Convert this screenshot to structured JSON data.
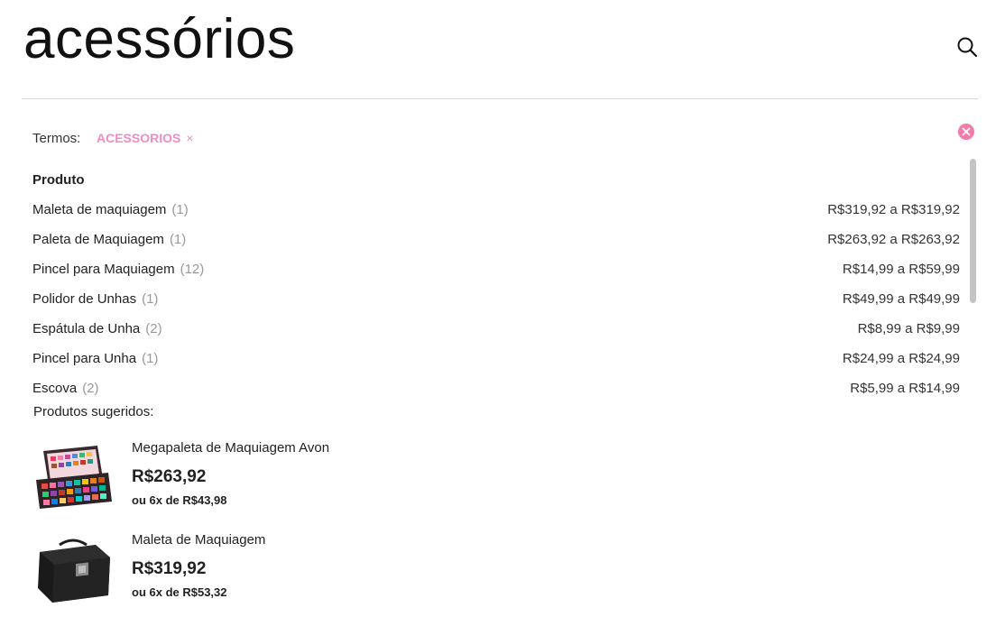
{
  "header": {
    "query": "acessórios",
    "search_icon": "search-icon"
  },
  "terms": {
    "label": "Termos:",
    "chip": "ACESSORIOS",
    "chip_remove": "×",
    "clear_icon": "close-circle-icon",
    "accent": "#f08bc3"
  },
  "filter": {
    "heading": "Produto",
    "items": [
      {
        "name": "Maleta de maquiagem",
        "count": "(1)",
        "range": "R$319,92 a R$319,92"
      },
      {
        "name": "Paleta de Maquiagem",
        "count": "(1)",
        "range": "R$263,92 a R$263,92"
      },
      {
        "name": "Pincel para Maquiagem",
        "count": "(12)",
        "range": "R$14,99 a R$59,99"
      },
      {
        "name": "Polidor de Unhas",
        "count": "(1)",
        "range": "R$49,99 a R$49,99"
      },
      {
        "name": "Espátula de Unha",
        "count": "(2)",
        "range": "R$8,99 a R$9,99"
      },
      {
        "name": "Pincel para Unha",
        "count": "(1)",
        "range": "R$24,99 a R$24,99"
      },
      {
        "name": "Escova",
        "count": "(2)",
        "range": "R$5,99 a R$14,99"
      }
    ]
  },
  "suggestions": {
    "title": "Produtos sugeridos:",
    "items": [
      {
        "name": "Megapaleta de Maquiagem Avon",
        "price": "R$263,92",
        "installments": "ou 6x de R$43,98"
      },
      {
        "name": "Maleta de Maquiagem",
        "price": "R$319,92",
        "installments": "ou 6x de R$53,32"
      }
    ]
  }
}
